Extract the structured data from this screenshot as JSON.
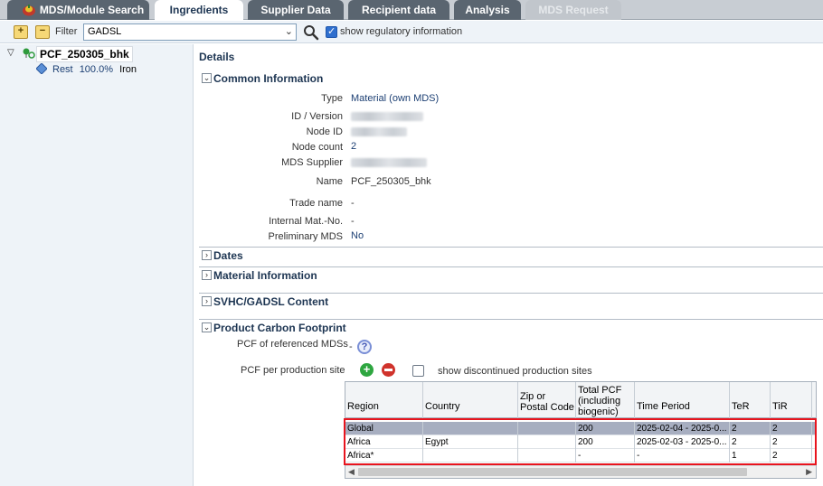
{
  "tabs": [
    {
      "label": "MDS/Module Search",
      "state": "normal"
    },
    {
      "label": "Ingredients",
      "state": "active"
    },
    {
      "label": "Supplier Data",
      "state": "normal"
    },
    {
      "label": "Recipient data",
      "state": "normal"
    },
    {
      "label": "Analysis",
      "state": "normal"
    },
    {
      "label": "MDS Request",
      "state": "disabled"
    }
  ],
  "toolbar": {
    "filter_label": "Filter",
    "filter_value": "GADSL",
    "show_regulatory_label": "show regulatory information",
    "show_regulatory_checked": true
  },
  "tree": {
    "root_label": "PCF_250305_bhk",
    "child_name": "Rest",
    "child_percent": "100.0%",
    "child_material": "Iron"
  },
  "details": {
    "title": "Details",
    "sections": {
      "common": "Common Information",
      "dates": "Dates",
      "material": "Material Information",
      "svhc": "SVHC/GADSL Content",
      "pcf": "Product Carbon Footprint"
    },
    "common_info": {
      "type_label": "Type",
      "type_value": "Material (own MDS)",
      "id_version_label": "ID / Version",
      "node_id_label": "Node ID",
      "node_count_label": "Node count",
      "node_count_value": "2",
      "supplier_label": "MDS Supplier",
      "name_label": "Name",
      "name_value": "PCF_250305_bhk",
      "trade_name_label": "Trade name",
      "trade_name_value": "-",
      "internal_mat_label": "Internal Mat.-No.",
      "internal_mat_value": "-",
      "preliminary_label": "Preliminary MDS",
      "preliminary_value": "No"
    },
    "pcf": {
      "referenced_label": "PCF of referenced MDSs",
      "referenced_value": "-",
      "per_site_label": "PCF per production site",
      "show_discontinued_label": "show discontinued production sites",
      "show_discontinued_checked": false,
      "columns": {
        "region": "Region",
        "country": "Country",
        "zip": "Zip or Postal Code",
        "total": "Total PCF (including biogenic)",
        "period": "Time Period",
        "ter": "TeR",
        "tir": "TiR"
      },
      "rows": [
        {
          "region": "Global",
          "country": "",
          "zip": "",
          "total": "200",
          "period": "2025-02-04 - 2025-0...",
          "ter": "2",
          "tir": "2"
        },
        {
          "region": "Africa",
          "country": "Egypt",
          "zip": "",
          "total": "200",
          "period": "2025-02-03 - 2025-0...",
          "ter": "2",
          "tir": "2"
        },
        {
          "region": "Africa*",
          "country": "",
          "zip": "",
          "total": "-",
          "period": "-",
          "ter": "1",
          "tir": "2"
        }
      ],
      "selected_row_index": 0
    }
  },
  "colors": {
    "tab_bar_bg": "#c8cdd3",
    "tab_inactive": "#5a6570",
    "section_title": "#1d3552",
    "link_value": "#1c3f73",
    "highlight_box": "#e8141e",
    "selected_row": "#a7aec0"
  }
}
